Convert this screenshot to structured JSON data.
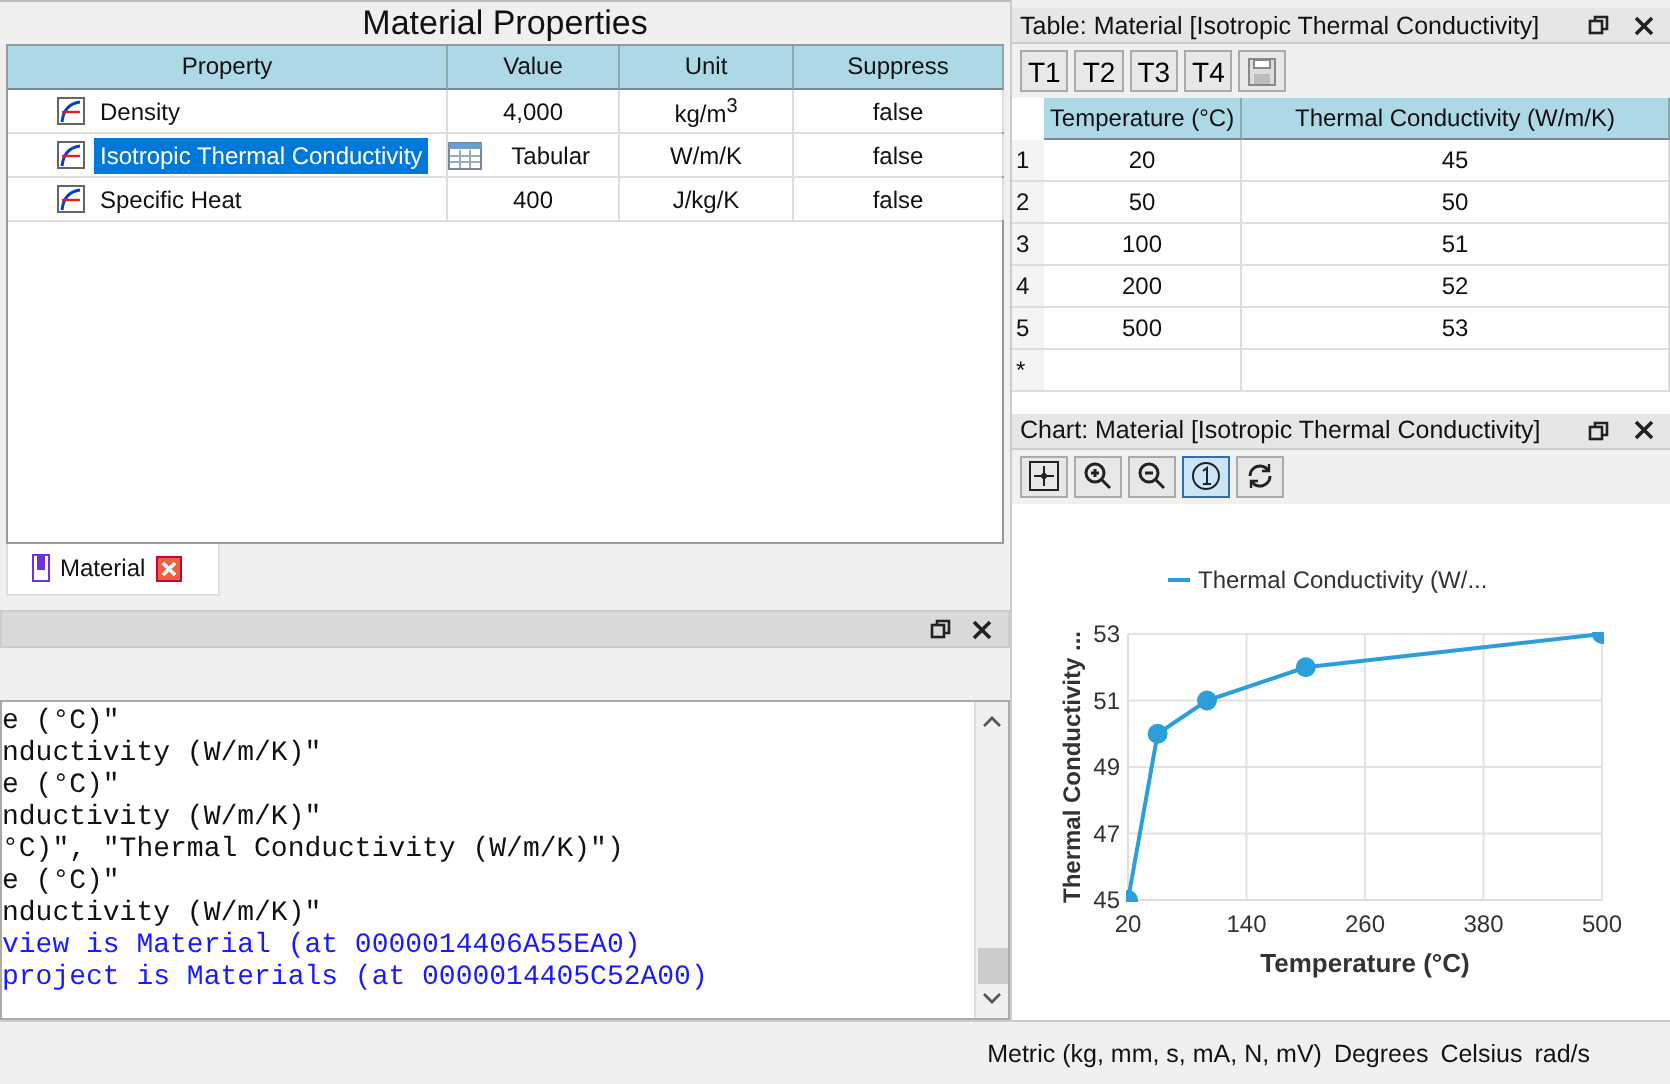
{
  "properties_panel": {
    "title": "Material Properties",
    "columns": [
      "Property",
      "Value",
      "Unit",
      "Suppress"
    ],
    "rows": [
      {
        "kind": "curve",
        "name": "Density",
        "value": "4,000",
        "table_icon": false,
        "unit": "kg/m$^{3}$",
        "suppress": "false",
        "selected": false
      },
      {
        "kind": "curve",
        "name": "Isotropic Thermal Conductivity",
        "value": "Tabular",
        "table_icon": true,
        "unit": "W/m/K",
        "suppress": "false",
        "selected": true
      },
      {
        "kind": "curve",
        "name": "Specific Heat",
        "value": "400",
        "table_icon": false,
        "unit": "J/kg/K",
        "suppress": "false",
        "selected": false
      }
    ]
  },
  "document_tabs": [
    {
      "label": "Material",
      "selected": true
    }
  ],
  "console": {
    "lines": [
      {
        "kind": "output",
        "text": "e (°C)\""
      },
      {
        "kind": "output",
        "text": "nductivity (W/m/K)\""
      },
      {
        "kind": "output",
        "text": "e (°C)\""
      },
      {
        "kind": "output",
        "text": "nductivity (W/m/K)\""
      },
      {
        "kind": "output",
        "text": "°C)\", \"Thermal Conductivity (W/m/K)\")"
      },
      {
        "kind": "output",
        "text": "e (°C)\""
      },
      {
        "kind": "output",
        "text": "nductivity (W/m/K)\""
      },
      {
        "kind": "info",
        "text": "view is Material (at 0000014406A55EA0)"
      },
      {
        "kind": "info",
        "text": "project is Materials (at 0000014405C52A00)"
      }
    ]
  },
  "table_panel": {
    "title": "Table: Material [Isotropic Thermal Conductivity]",
    "tools": [
      {
        "kind": "text",
        "label": "T1"
      },
      {
        "kind": "text",
        "label": "T2"
      },
      {
        "kind": "text",
        "label": "T3"
      },
      {
        "kind": "text",
        "label": "T4"
      },
      {
        "kind": "save"
      }
    ],
    "columns": [
      "Temperature (°C)",
      "Thermal Conductivity (W/m/K)"
    ],
    "rows": [
      {
        "index": "1",
        "cells": [
          "20",
          "45"
        ]
      },
      {
        "index": "2",
        "cells": [
          "50",
          "50"
        ]
      },
      {
        "index": "3",
        "cells": [
          "100",
          "51"
        ]
      },
      {
        "index": "4",
        "cells": [
          "200",
          "52"
        ]
      },
      {
        "index": "5",
        "cells": [
          "500",
          "53"
        ]
      }
    ],
    "new_row_marker": "*"
  },
  "chart_panel": {
    "title": "Chart: Material [Isotropic Thermal Conductivity]",
    "tools": [
      {
        "kind": "fit",
        "selected": false
      },
      {
        "kind": "zoom-in",
        "selected": false
      },
      {
        "kind": "zoom-out",
        "selected": false
      },
      {
        "kind": "one",
        "selected": true
      },
      {
        "kind": "refresh",
        "selected": false
      }
    ],
    "chart_data": {
      "type": "line",
      "xlabel": "Temperature (°C)",
      "ylabel": "Thermal Conductivity ...",
      "x": [
        20,
        50,
        100,
        200,
        500
      ],
      "series": [
        {
          "name": "Thermal Conductivity (W/...",
          "color": "#2a9fd8",
          "marker": "circle",
          "values": [
            45,
            50,
            51,
            52,
            53
          ]
        }
      ],
      "grid": true,
      "xlim": [
        20,
        500
      ],
      "ylim": [
        45,
        53
      ],
      "xticks": [
        20,
        140,
        260,
        380,
        500
      ],
      "yticks": [
        45,
        47,
        49,
        51,
        53
      ]
    }
  },
  "status_bar": [
    "Metric (kg, mm, s, mA, N, mV)",
    "Degrees",
    "Celsius",
    "rad/s"
  ]
}
